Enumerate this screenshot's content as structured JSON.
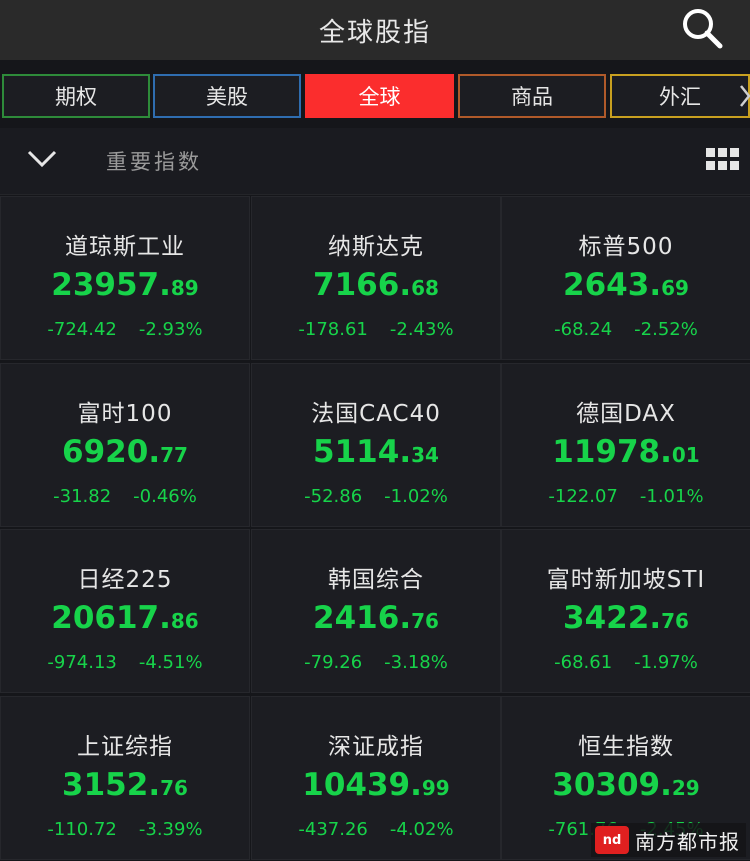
{
  "header": {
    "title": "全球股指",
    "search_icon": "search-icon"
  },
  "tabs": [
    {
      "label": "期权",
      "border_color": "#2e8b3a",
      "active": false
    },
    {
      "label": "美股",
      "border_color": "#2f6db0",
      "active": false
    },
    {
      "label": "全球",
      "border_color": "#fb2d2d",
      "active": true
    },
    {
      "label": "商品",
      "border_color": "#b05a2a",
      "active": false
    },
    {
      "label": "外汇",
      "border_color": "#c8a020",
      "active": false
    }
  ],
  "subbar": {
    "title": "重要指数",
    "collapse_icon": "chevron-down-icon",
    "grid_icon": "grid-view-icon"
  },
  "colors": {
    "down": "#17d34a",
    "accent": "#fb2d2d"
  },
  "indices": [
    {
      "name": "道琼斯工业",
      "price_int": "23957",
      "price_frac": "89",
      "change": "-724.42",
      "pct": "-2.93%"
    },
    {
      "name": "纳斯达克",
      "price_int": "7166",
      "price_frac": "68",
      "change": "-178.61",
      "pct": "-2.43%"
    },
    {
      "name": "标普500",
      "price_int": "2643",
      "price_frac": "69",
      "change": "-68.24",
      "pct": "-2.52%"
    },
    {
      "name": "富时100",
      "price_int": "6920",
      "price_frac": "77",
      "change": "-31.82",
      "pct": "-0.46%"
    },
    {
      "name": "法国CAC40",
      "price_int": "5114",
      "price_frac": "34",
      "change": "-52.86",
      "pct": "-1.02%"
    },
    {
      "name": "德国DAX",
      "price_int": "11978",
      "price_frac": "01",
      "change": "-122.07",
      "pct": "-1.01%"
    },
    {
      "name": "日经225",
      "price_int": "20617",
      "price_frac": "86",
      "change": "-974.13",
      "pct": "-4.51%"
    },
    {
      "name": "韩国综合",
      "price_int": "2416",
      "price_frac": "76",
      "change": "-79.26",
      "pct": "-3.18%"
    },
    {
      "name": "富时新加坡STI",
      "price_int": "3422",
      "price_frac": "76",
      "change": "-68.61",
      "pct": "-1.97%"
    },
    {
      "name": "上证综指",
      "price_int": "3152",
      "price_frac": "76",
      "change": "-110.72",
      "pct": "-3.39%"
    },
    {
      "name": "深证成指",
      "price_int": "10439",
      "price_frac": "99",
      "change": "-437.26",
      "pct": "-4.02%"
    },
    {
      "name": "恒生指数",
      "price_int": "30309",
      "price_frac": "29",
      "change": "-761.76",
      "pct": "-2.45%"
    }
  ],
  "watermark": {
    "text": "南方都市报",
    "logo_icon": "nd-logo-icon"
  }
}
